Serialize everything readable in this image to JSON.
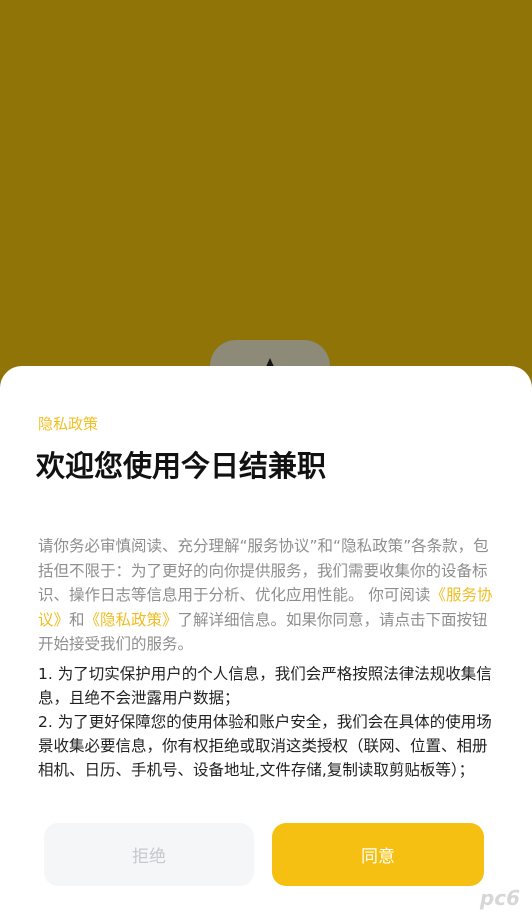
{
  "dialog": {
    "eyebrow": "隐私政策",
    "title": "欢迎您使用今日结兼职",
    "intro": {
      "part1": "请你务必审慎阅读、充分理解“服务协议”和“隐私政策”各条款，包括但不限于：为了更好的向你提供服务，我们需要收集你的设备标识、操作日志等信息用于分析、优化应用性能。 你可阅读",
      "link1": "《服务协议》",
      "and_text": "和",
      "link2": "《隐私政策》",
      "part2": "了解详细信息。如果你同意，请点击下面按钮开始接受我们的服务。"
    },
    "items": [
      "1. 为了切实保护用户的个人信息，我们会严格按照法律法规收集信息，且绝不会泄露用户数据；",
      "2. 为了更好保障您的使用体验和账户安全，我们会在具体的使用场景收集必要信息，你有权拒绝或取消这类授权（联网、位置、相册相机、日历、手机号、设备地址,文件存储,复制读取剪贴板等）；"
    ],
    "refuse_label": "拒绝",
    "agree_label": "同意"
  },
  "watermark": "pc6",
  "colors": {
    "background": "#907408",
    "accent": "#f5c012",
    "link": "#f1bc22"
  }
}
